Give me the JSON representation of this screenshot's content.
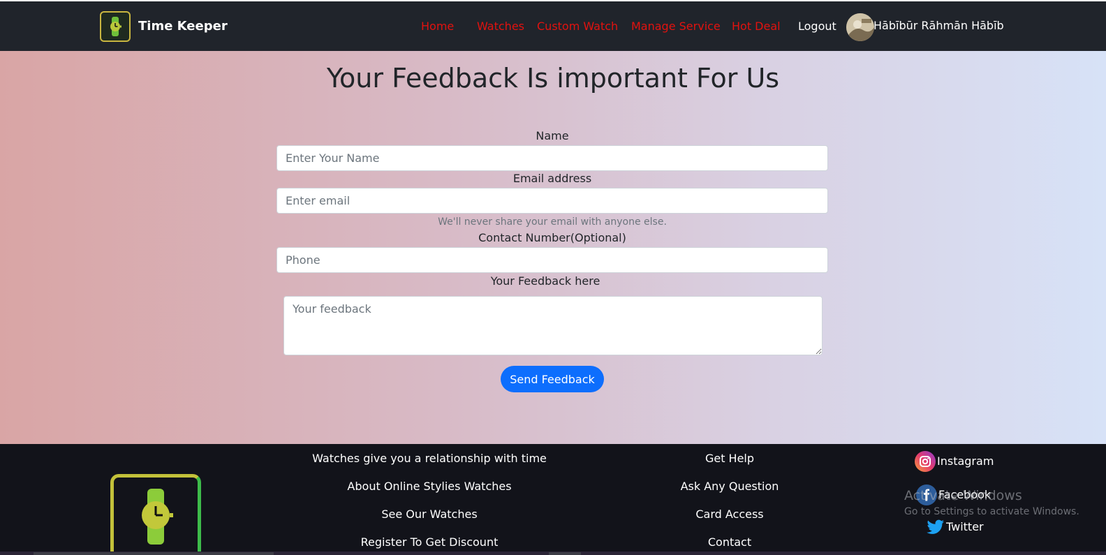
{
  "brand": {
    "name": "Time Keeper"
  },
  "nav": {
    "links": [
      "Home",
      "Watches",
      "Custom Watch",
      "Manage Service",
      "Hot Deal"
    ],
    "logout": "Logout",
    "user_name": "Hābībūr Rāhmān Hābīb"
  },
  "feedback": {
    "title": "Your Feedback Is important For Us",
    "name_label": "Name",
    "name_placeholder": "Enter Your Name",
    "email_label": "Email address",
    "email_placeholder": "Enter email",
    "email_help": "We'll never share your email with anyone else.",
    "phone_label": "Contact Number(Optional)",
    "phone_placeholder": "Phone",
    "feedback_label": "Your Feedback here",
    "feedback_placeholder": "Your feedback",
    "submit": "Send Feedback"
  },
  "footer": {
    "col1": [
      "Watches give you a relationship with time",
      "About Online Stylies Watches",
      "See Our Watches",
      "Register To Get Discount"
    ],
    "col2": [
      "Get Help",
      "Ask Any Question",
      "Card Access",
      "Contact"
    ],
    "social": [
      {
        "name": "Instagram",
        "icon": "instagram-icon"
      },
      {
        "name": "Facebook",
        "icon": "facebook-icon"
      },
      {
        "name": "Twitter",
        "icon": "twitter-icon"
      }
    ]
  },
  "os_watermark": {
    "title": "Activate Windows",
    "subtitle": "Go to Settings to activate Windows."
  },
  "colors": {
    "nav_link": "#e2120f",
    "primary": "#0d6efd",
    "nav_bg": "#20242b",
    "footer_bg": "#12131a"
  }
}
